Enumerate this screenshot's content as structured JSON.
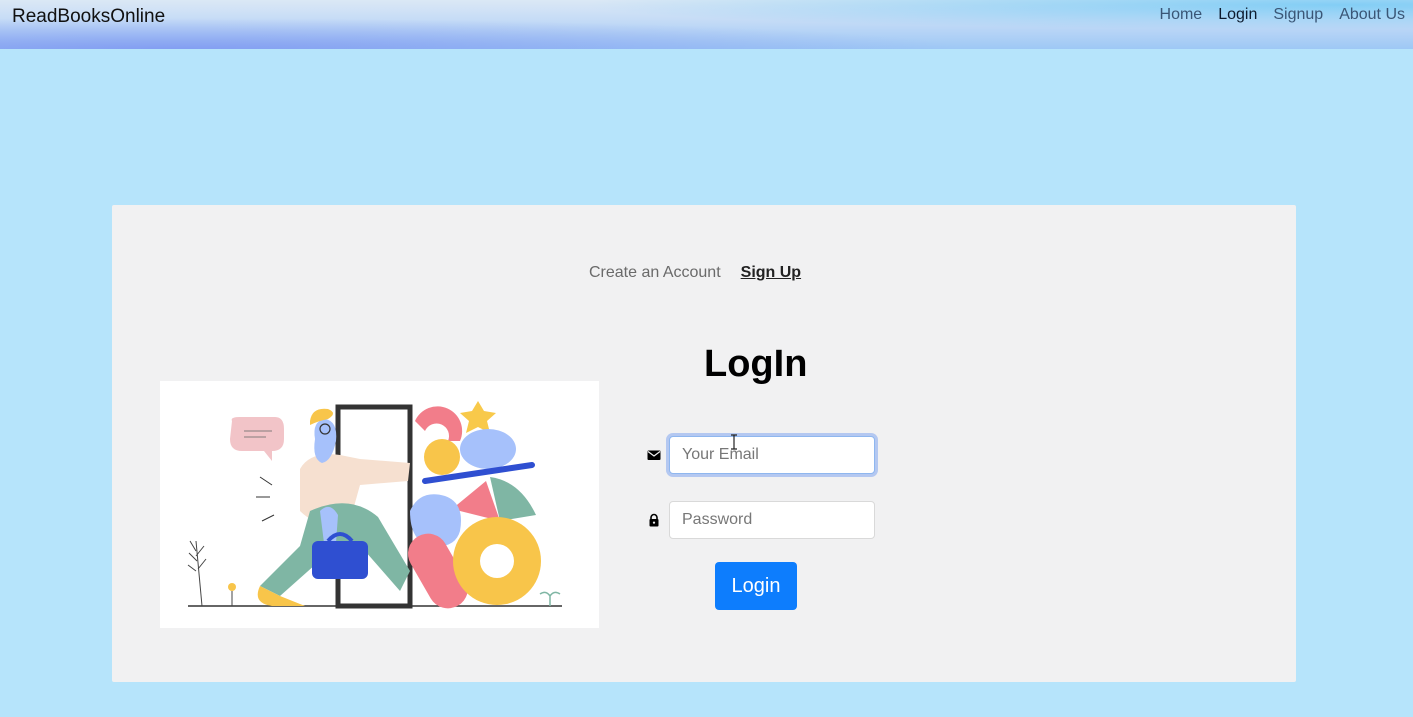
{
  "navbar": {
    "brand": "ReadBooksOnline",
    "links": [
      {
        "label": "Home",
        "active": false
      },
      {
        "label": "Login",
        "active": true
      },
      {
        "label": "Signup",
        "active": false
      },
      {
        "label": "About Us",
        "active": false
      }
    ]
  },
  "signup_prompt": {
    "text": "Create an Account",
    "link_label": "Sign Up"
  },
  "login_form": {
    "title": "LogIn",
    "email": {
      "placeholder": "Your Email",
      "value": "",
      "icon": "envelope-icon"
    },
    "password": {
      "placeholder": "Password",
      "value": "",
      "icon": "lock-icon"
    },
    "submit_label": "Login"
  },
  "illustration": {
    "icon": "person-opening-door-illustration"
  },
  "colors": {
    "page_background": "#b6e4fb",
    "card_background": "#f1f1f2",
    "button_primary": "#0d7dfd"
  }
}
